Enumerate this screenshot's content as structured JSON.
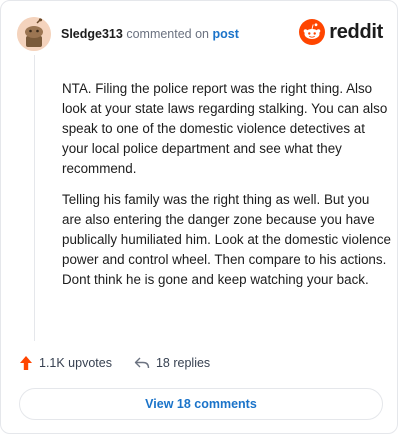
{
  "comment": {
    "author": "Sledge313",
    "action_text": "commented on",
    "post_link": "post",
    "paragraphs": [
      "NTA. Filing the police report was the right thing. Also look at your state laws regarding stalking. You can also speak to one of the domestic violence detectives at your local police department and see what they recommend.",
      "Telling his family was the right thing as well. But you are also entering the danger zone because you have publically humiliated him. Look at the domestic violence power and control wheel. Then compare to his actions. Dont think he is gone and keep watching your back."
    ]
  },
  "brand": {
    "wordmark": "reddit",
    "icon": "reddit-alien-icon",
    "color": "#ff4500"
  },
  "actions": {
    "upvotes_label": "1.1K upvotes",
    "upvote_icon": "upvote-arrow-icon",
    "replies_label": "18 replies",
    "reply_icon": "reply-arrow-icon"
  },
  "footer": {
    "view_comments_label": "View 18 comments"
  },
  "colors": {
    "accent_link": "#1a73c9",
    "upvote": "#ff4500",
    "border": "#e5e7eb"
  }
}
